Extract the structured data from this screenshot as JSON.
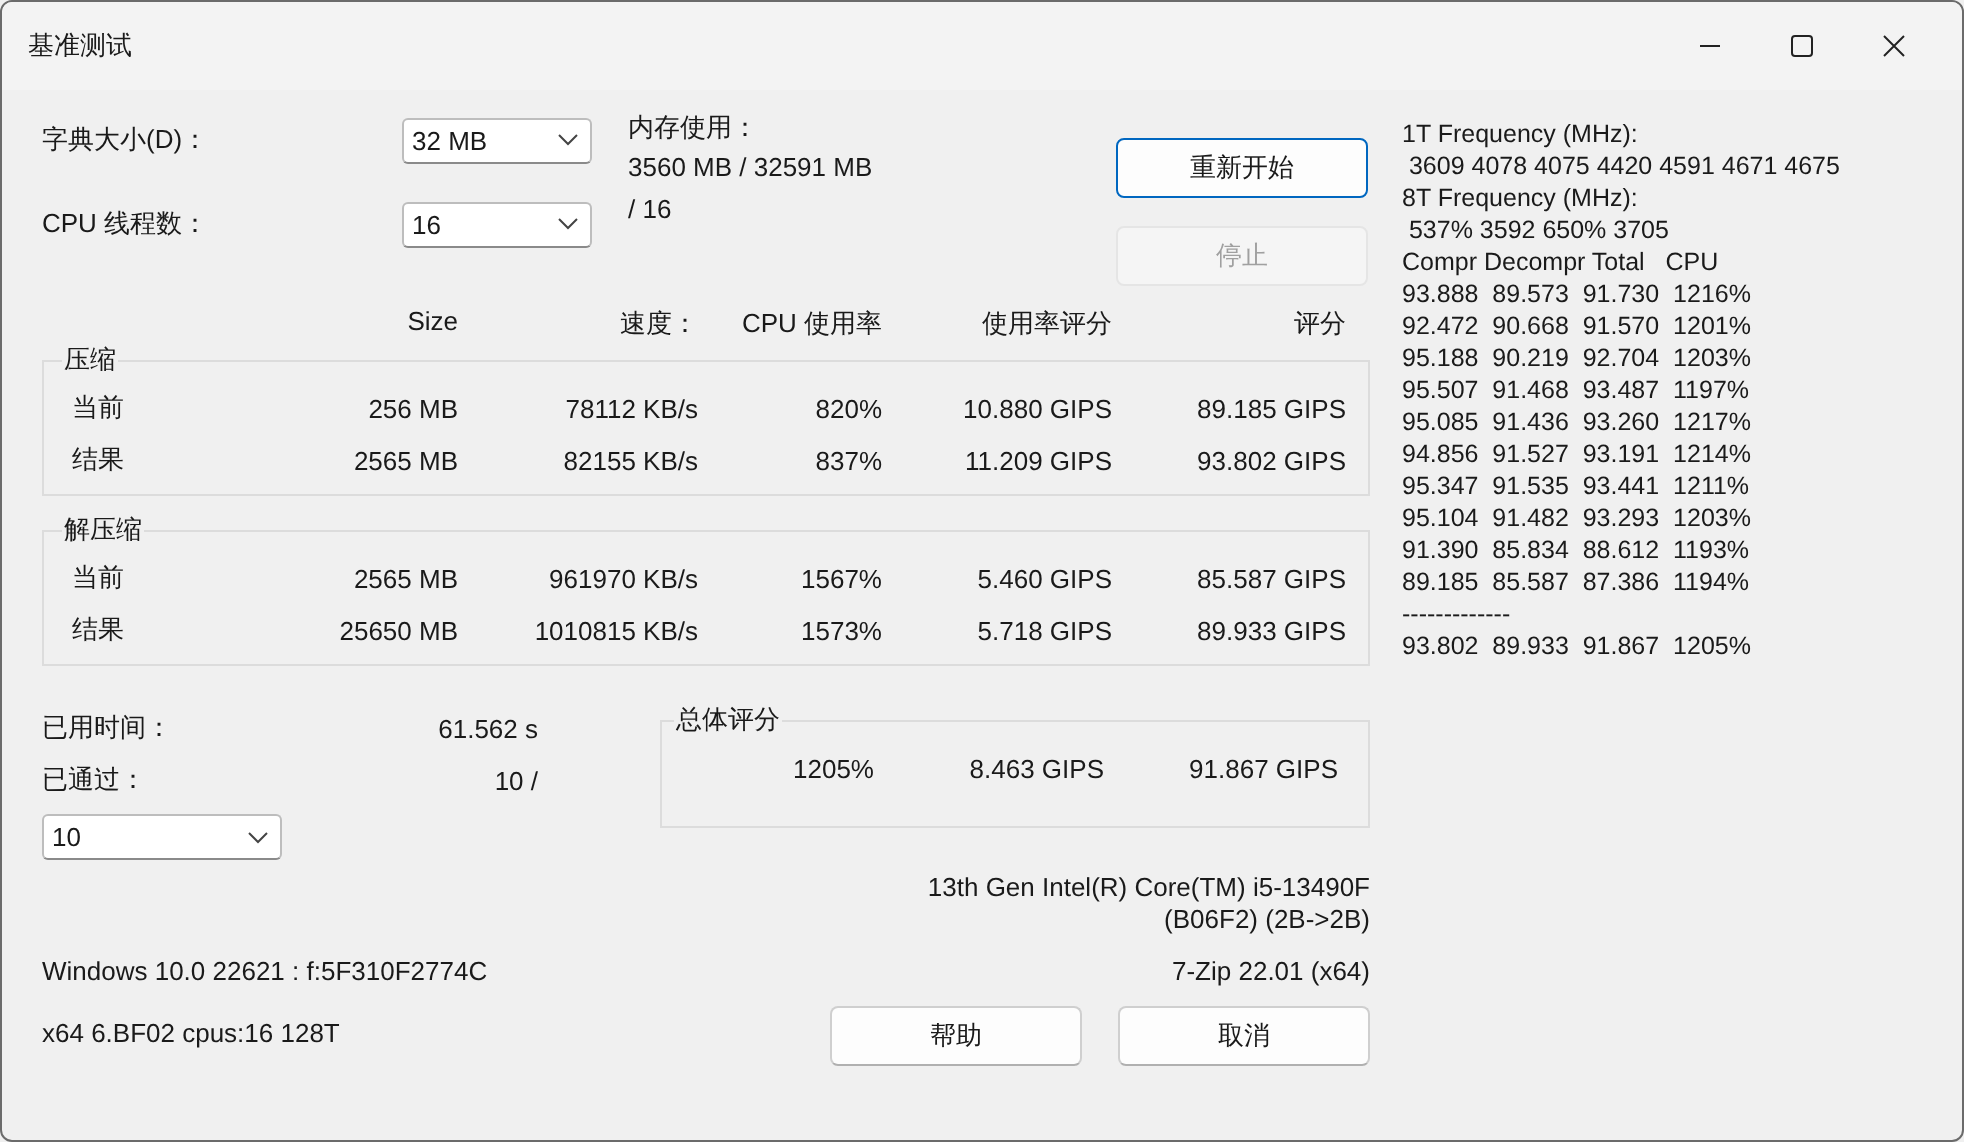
{
  "window": {
    "title": "基准测试"
  },
  "dictionary": {
    "label": "字典大小(D)：",
    "value": "32 MB"
  },
  "memory": {
    "label": "内存使用：",
    "value": "3560 MB / 32591 MB"
  },
  "threads": {
    "label": "CPU 线程数：",
    "value": "16",
    "total": "/ 16"
  },
  "actions": [
    {
      "label": "重新开始",
      "disabled": false
    },
    {
      "label": "停止",
      "disabled": true
    }
  ],
  "columns": [
    "Size",
    "速度：",
    "CPU 使用率",
    "使用率评分",
    "评分"
  ],
  "groups": [
    {
      "title": "压缩",
      "rows": [
        {
          "label": "当前",
          "cells": [
            "256 MB",
            "78112 KB/s",
            "820%",
            "10.880 GIPS",
            "89.185 GIPS"
          ]
        },
        {
          "label": "结果",
          "cells": [
            "2565 MB",
            "82155 KB/s",
            "837%",
            "11.209 GIPS",
            "93.802 GIPS"
          ]
        }
      ]
    },
    {
      "title": "解压缩",
      "rows": [
        {
          "label": "当前",
          "cells": [
            "2565 MB",
            "961970 KB/s",
            "1567%",
            "5.460 GIPS",
            "85.587 GIPS"
          ]
        },
        {
          "label": "结果",
          "cells": [
            "25650 MB",
            "1010815 KB/s",
            "1573%",
            "5.718 GIPS",
            "89.933 GIPS"
          ]
        }
      ]
    }
  ],
  "elapsed": {
    "label": "已用时间：",
    "value": "61.562 s"
  },
  "passes": {
    "label": "已通过：",
    "value": "10 /",
    "select": "10"
  },
  "total": {
    "title": "总体评分",
    "cells": [
      "1205%",
      "8.463 GIPS",
      "91.867 GIPS"
    ]
  },
  "cpu_info": [
    "13th Gen Intel(R) Core(TM) i5-13490F",
    "(B06F2) (2B->2B)"
  ],
  "os_info": "Windows 10.0 22621 : f:5F310F2774C",
  "version": "7-Zip 22.01 (x64)",
  "build_info": "x64 6.BF02 cpus:16 128T",
  "bottom_buttons": [
    "帮助",
    "取消"
  ],
  "log": [
    "1T Frequency (MHz):",
    " 3609 4078 4075 4420 4591 4671 4675",
    "8T Frequency (MHz):",
    " 537% 3592 650% 3705",
    "Compr Decompr Total   CPU",
    "93.888  89.573  91.730  1216%",
    "92.472  90.668  91.570  1201%",
    "95.188  90.219  92.704  1203%",
    "95.507  91.468  93.487  1197%",
    "95.085  91.436  93.260  1217%",
    "94.856  91.527  93.191  1214%",
    "95.347  91.535  93.441  1211%",
    "95.104  91.482  93.293  1203%",
    "91.390  85.834  88.612  1193%",
    "89.185  85.587  87.386  1194%",
    "-------------",
    "93.802  89.933  91.867  1205%"
  ]
}
